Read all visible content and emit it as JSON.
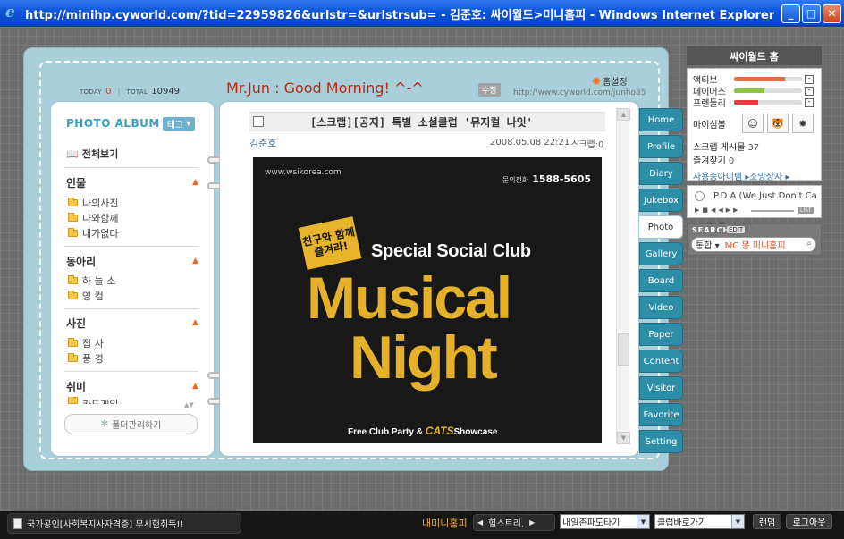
{
  "window": {
    "title": "http://minihp.cyworld.com/?tid=22959826&urlstr=&urlstrsub= - 김준호: 싸이월드>미니홈피 - Windows Internet Explorer"
  },
  "header": {
    "today_label": "TODAY",
    "today_value": "0",
    "total_label": "TOTAL",
    "total_value": "10949",
    "title": "Mr.Jun : Good Morning! ^-^",
    "edit_label": "수정",
    "home_setting": "홈설정",
    "url": "http://www.cyworld.com/junho85"
  },
  "album": {
    "heading": "PHOTO ALBUM",
    "tag_label": "태그",
    "view_all": "전체보기",
    "groups": [
      {
        "title": "인물",
        "items": [
          "나의사진",
          "나와함께",
          "내가없다"
        ]
      },
      {
        "title": "동아리",
        "items": [
          "하 늘 소",
          "영 컴"
        ]
      },
      {
        "title": "사진",
        "items": [
          "접 사",
          "풍 경"
        ]
      },
      {
        "title": "취미",
        "items": [
          "카드게임"
        ]
      }
    ],
    "folder_manage": "폴더관리하기"
  },
  "post": {
    "title": "[스크랩][공지] 특별 소셜클럽 '뮤지컬 나잇'",
    "author": "김준호",
    "date": "2008.05.08 22:21",
    "scrap": "스크랩:0",
    "poster": {
      "site": "www.wsikorea.com",
      "phone_label": "문의전화",
      "phone": "1588-5605",
      "badge": "친구와 함께 즐겨라!",
      "subtitle": "Special Social Club",
      "headline1": "Musical",
      "headline2": "Night",
      "footer_prefix": "Free Club Party & ",
      "footer_cats": "CATS",
      "footer_suffix": "Showcase"
    }
  },
  "nav_tabs": [
    "Home",
    "Profile",
    "Diary",
    "Jukebox",
    "Photo",
    "Gallery",
    "Board",
    "Video",
    "Paper",
    "Content",
    "Visitor",
    "Favorite",
    "Setting"
  ],
  "nav_active": "Photo",
  "sidebar": {
    "home_title": "싸이월드 홈",
    "meters": [
      {
        "label": "액티브",
        "level": 0.75,
        "color": "#e96a3b"
      },
      {
        "label": "페이머스",
        "level": 0.45,
        "color": "#8cc63f"
      },
      {
        "label": "프렌들리",
        "level": 0.35,
        "color": "#e33e3e"
      }
    ],
    "mini_label": "마이심볼",
    "scrap_board_label": "스크랩 게시물",
    "scrap_board_count": "37",
    "favorites_label": "즐겨찾기",
    "favorites_count": "0",
    "links": "사용중아이템 ▸소망상자 ▸",
    "player_title": "P.D.A (We Just Don't Care)",
    "player_list": "LIST",
    "search_title": "SEARCH",
    "search_edit": "EDIT",
    "search_select": "통합 ▾",
    "search_value": "MC 몽 미니홈피"
  },
  "bottom": {
    "ad_text": "국가공인[사회복지사자격증] 무시험취득!!",
    "my_mini": "내미니홈피",
    "friend_nav": "헐스트리,",
    "dropdown1": "내일촌파도타기",
    "dropdown2": "클럽바로가기",
    "random": "랜덤",
    "logout": "로그아웃"
  }
}
